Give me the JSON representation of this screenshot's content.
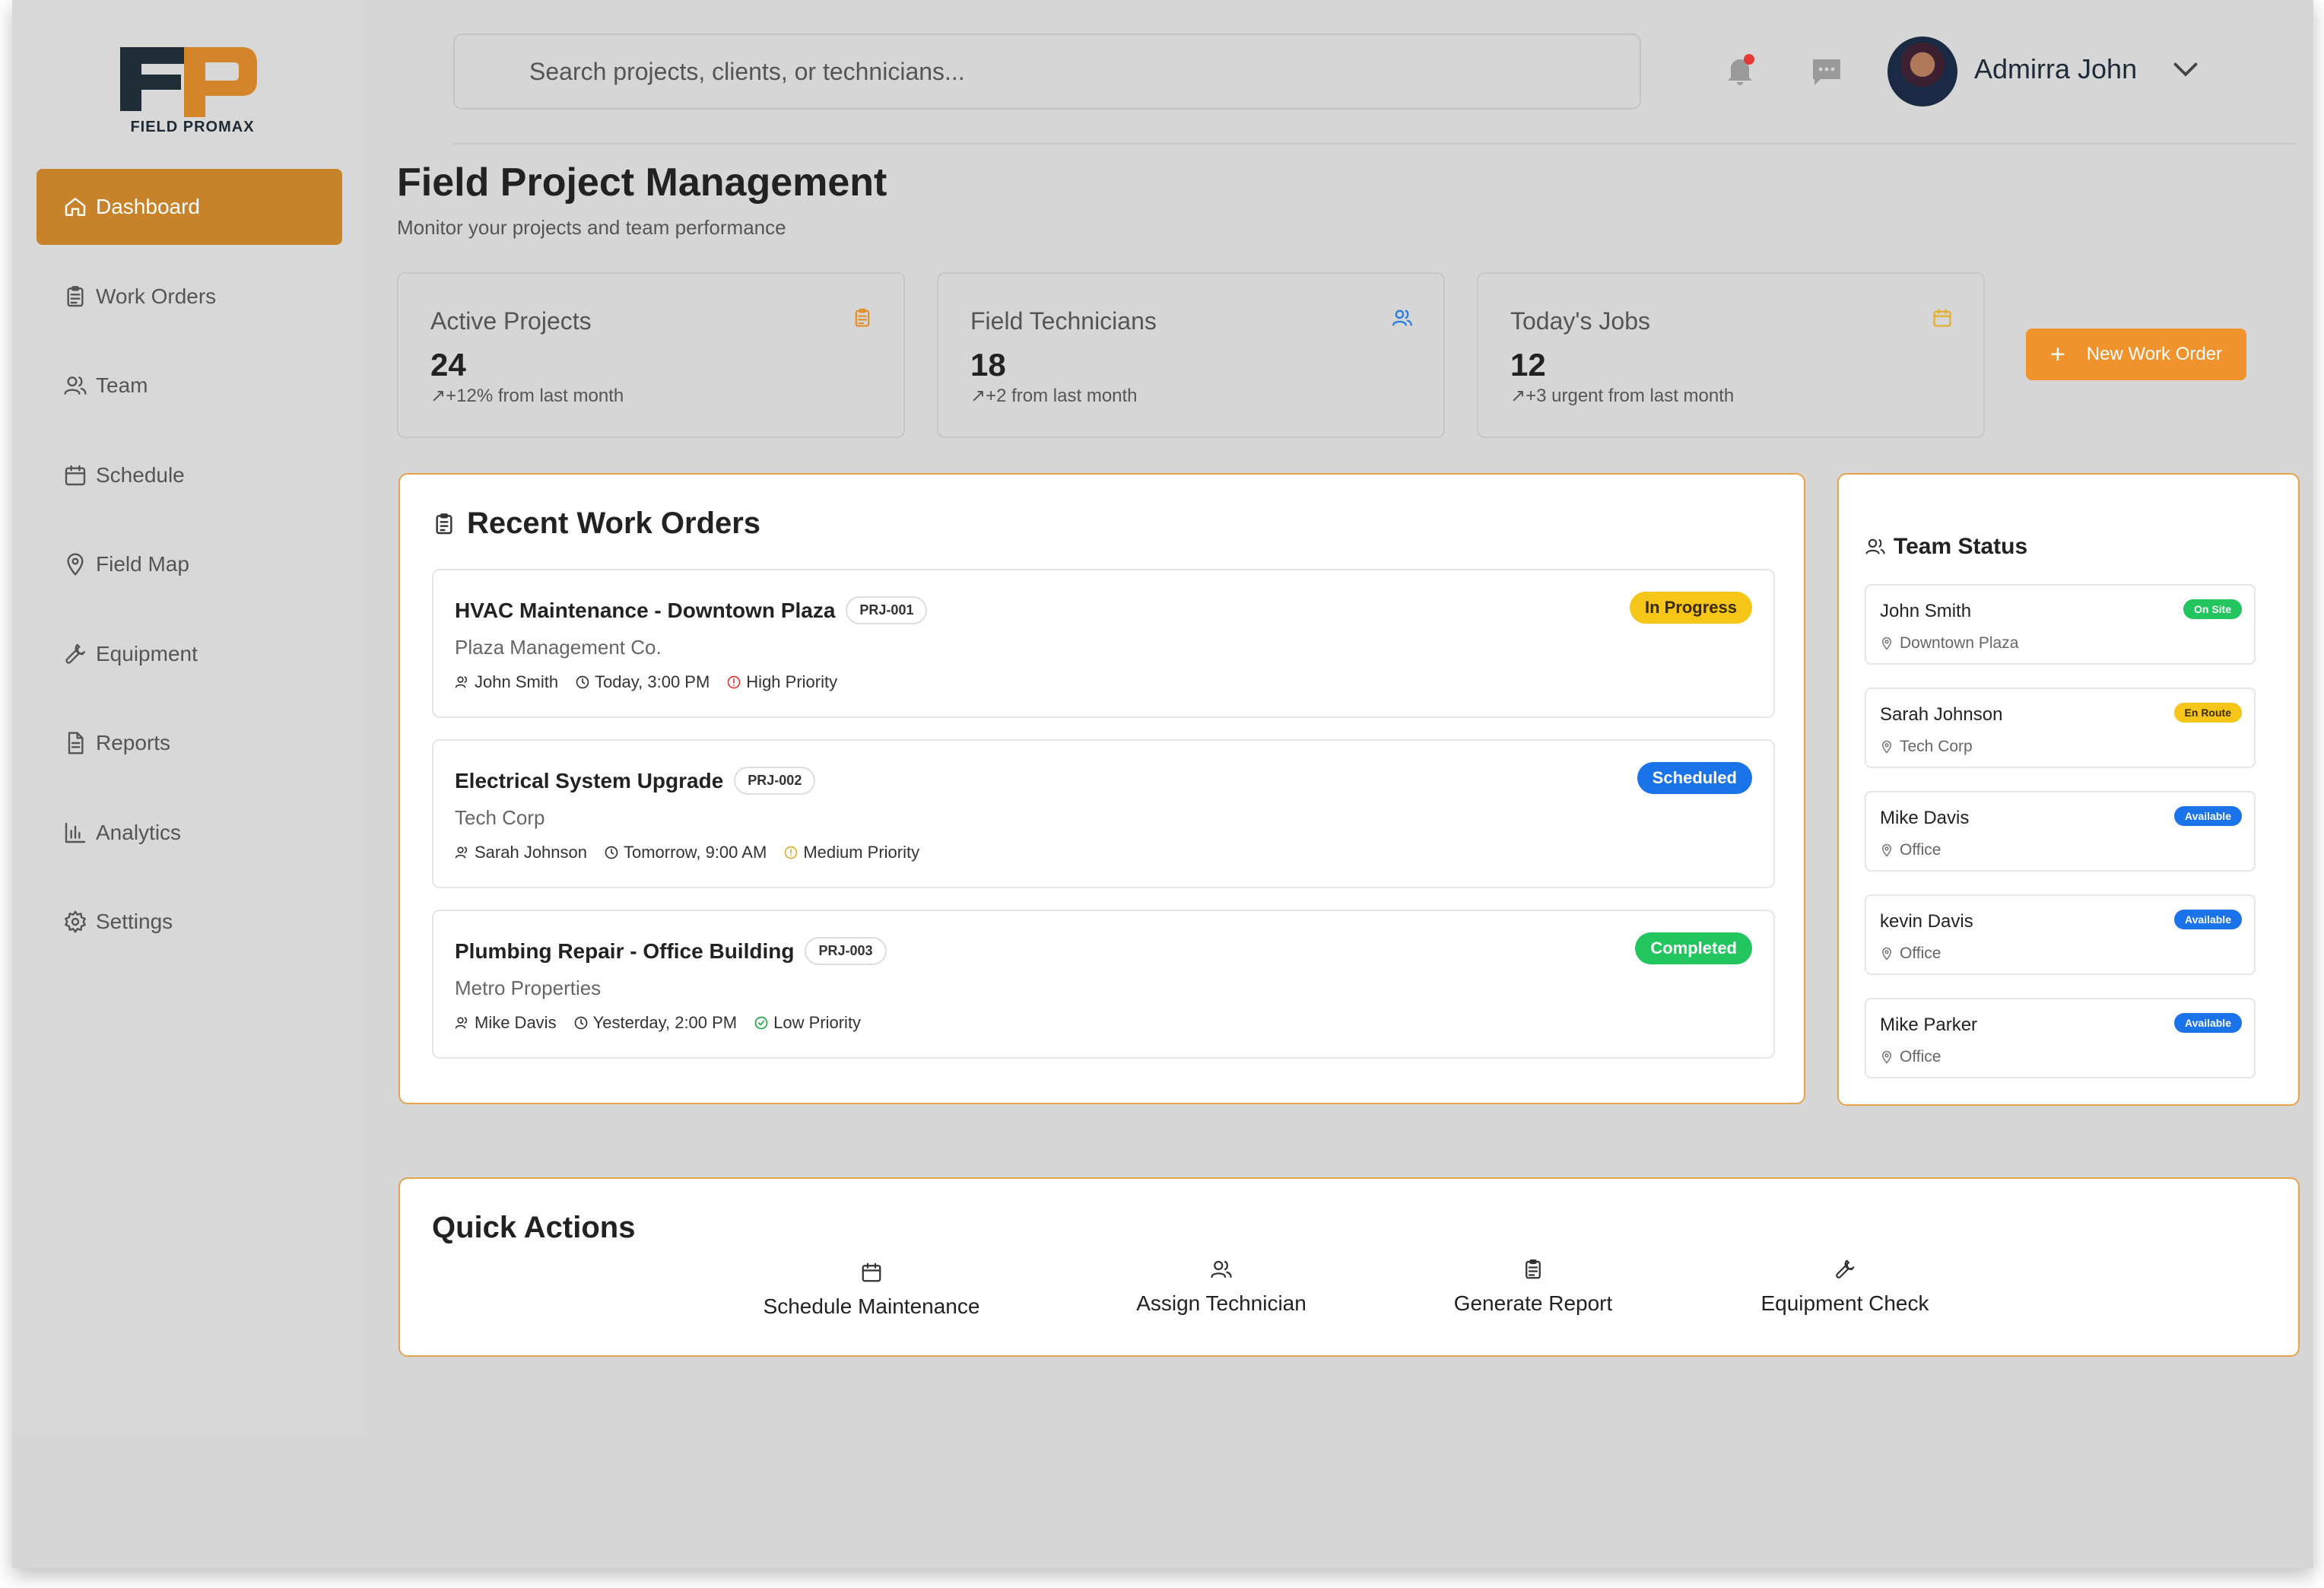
{
  "brand": {
    "name": "FIELD PROMAX",
    "logo_letters": "FP",
    "accent": "#c8832a"
  },
  "sidebar": {
    "items": [
      {
        "label": "Dashboard",
        "icon": "home-icon",
        "active": true
      },
      {
        "label": "Work Orders",
        "icon": "clipboard-icon"
      },
      {
        "label": "Team",
        "icon": "users-icon"
      },
      {
        "label": "Schedule",
        "icon": "calendar-icon"
      },
      {
        "label": "Field Map",
        "icon": "map-pin-icon"
      },
      {
        "label": "Equipment",
        "icon": "wrench-icon"
      },
      {
        "label": "Reports",
        "icon": "file-text-icon"
      },
      {
        "label": "Analytics",
        "icon": "bar-chart-icon"
      },
      {
        "label": "Settings",
        "icon": "gear-icon"
      }
    ]
  },
  "header": {
    "search_placeholder": "Search projects, clients, or technicians...",
    "user_name": "Admirra John",
    "notification_dot": "#e53935"
  },
  "page": {
    "title": "Field Project Management",
    "subtitle": "Monitor your projects and team performance"
  },
  "stats": [
    {
      "label": "Active Projects",
      "value": "24",
      "change": "+12% from last month",
      "icon": "clipboard-icon",
      "icon_color": "#e0922e"
    },
    {
      "label": "Field Technicians",
      "value": "18",
      "change": "+2 from last month",
      "icon": "users-icon",
      "icon_color": "#2a7de1"
    },
    {
      "label": "Today's Jobs",
      "value": "12",
      "change": "+3 urgent from last month",
      "icon": "calendar-icon",
      "icon_color": "#e0b02e"
    }
  ],
  "actions": {
    "new_work_order": "New Work Order"
  },
  "work_orders": {
    "title": "Recent Work Orders",
    "items": [
      {
        "name": "HVAC Maintenance - Downtown Plaza",
        "code": "PRJ-001",
        "client": "Plaza Management Co.",
        "tech": "John Smith",
        "time": "Today, 3:00 PM",
        "priority": "High Priority",
        "priority_color": "#e53935",
        "status": "In Progress",
        "status_bg": "#f5c518",
        "status_fg": "#3a2a00"
      },
      {
        "name": "Electrical System Upgrade",
        "code": "PRJ-002",
        "client": "Tech Corp",
        "tech": "Sarah Johnson",
        "time": "Tomorrow, 9:00 AM",
        "priority": "Medium Priority",
        "priority_color": "#e0b02e",
        "status": "Scheduled",
        "status_bg": "#1a73e8",
        "status_fg": "#ffffff"
      },
      {
        "name": "Plumbing Repair - Office Building",
        "code": "PRJ-003",
        "client": "Metro Properties",
        "tech": "Mike Davis",
        "time": "Yesterday, 2:00 PM",
        "priority": "Low Priority",
        "priority_color": "#22a447",
        "status": "Completed",
        "status_bg": "#22c55e",
        "status_fg": "#ffffff"
      }
    ]
  },
  "team_status": {
    "title": "Team Status",
    "members": [
      {
        "name": "John Smith",
        "location": "Downtown Plaza",
        "status": "On Site",
        "status_bg": "#22c55e",
        "status_fg": "#ffffff"
      },
      {
        "name": "Sarah Johnson",
        "location": "Tech Corp",
        "status": "En Route",
        "status_bg": "#f5c518",
        "status_fg": "#3a2a00"
      },
      {
        "name": "Mike Davis",
        "location": "Office",
        "status": "Available",
        "status_bg": "#1a73e8",
        "status_fg": "#ffffff"
      },
      {
        "name": "kevin Davis",
        "location": "Office",
        "status": "Available",
        "status_bg": "#1a73e8",
        "status_fg": "#ffffff"
      },
      {
        "name": "Mike Parker",
        "location": "Office",
        "status": "Available",
        "status_bg": "#1a73e8",
        "status_fg": "#ffffff"
      }
    ]
  },
  "quick_actions": {
    "title": "Quick Actions",
    "items": [
      {
        "label": "Schedule Maintenance",
        "icon": "calendar-icon"
      },
      {
        "label": "Assign Technician",
        "icon": "users-icon"
      },
      {
        "label": "Generate Report",
        "icon": "clipboard-icon"
      },
      {
        "label": "Equipment Check",
        "icon": "wrench-icon"
      }
    ]
  }
}
